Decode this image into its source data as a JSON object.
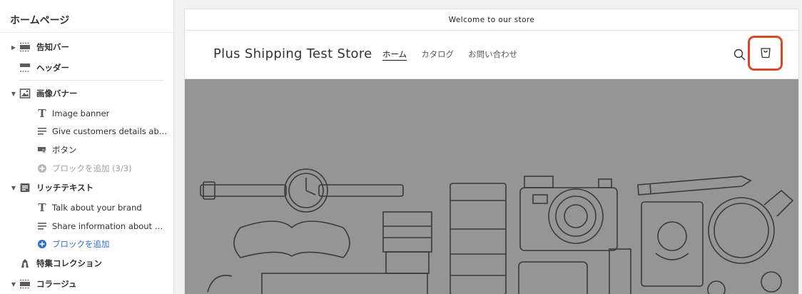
{
  "sidebar": {
    "title": "ホームページ",
    "items": [
      {
        "label": "告知バー",
        "icon": "section-icon"
      },
      {
        "label": "ヘッダー",
        "icon": "header-icon"
      },
      {
        "label": "画像バナー",
        "icon": "image-icon"
      },
      {
        "label": "Image banner",
        "icon": "text-icon"
      },
      {
        "label": "Give customers details about the banner image(s) or content on the template.",
        "icon": "paragraph-icon"
      },
      {
        "label": "ボタン",
        "icon": "button-icon"
      },
      {
        "label": "ブロックを追加 (3/3)",
        "icon": "add-circle-icon"
      },
      {
        "label": "リッチテキスト",
        "icon": "rich-text-icon"
      },
      {
        "label": "Talk about your brand",
        "icon": "text-icon"
      },
      {
        "label": "Share information about your brand with your customers.",
        "icon": "paragraph-icon"
      },
      {
        "label": "ブロックを追加",
        "icon": "add-circle-icon"
      },
      {
        "label": "特集コレクション",
        "icon": "collection-icon"
      },
      {
        "label": "コラージュ",
        "icon": "section-icon"
      }
    ]
  },
  "preview": {
    "announcement": "Welcome to our store",
    "store_name": "Plus Shipping Test Store",
    "nav": [
      "ホーム",
      "カタログ",
      "お問い合わせ"
    ],
    "search_icon": "search-icon",
    "cart_icon": "cart-icon",
    "highlight_color": "#d9482b",
    "banner_color": "#959595"
  }
}
